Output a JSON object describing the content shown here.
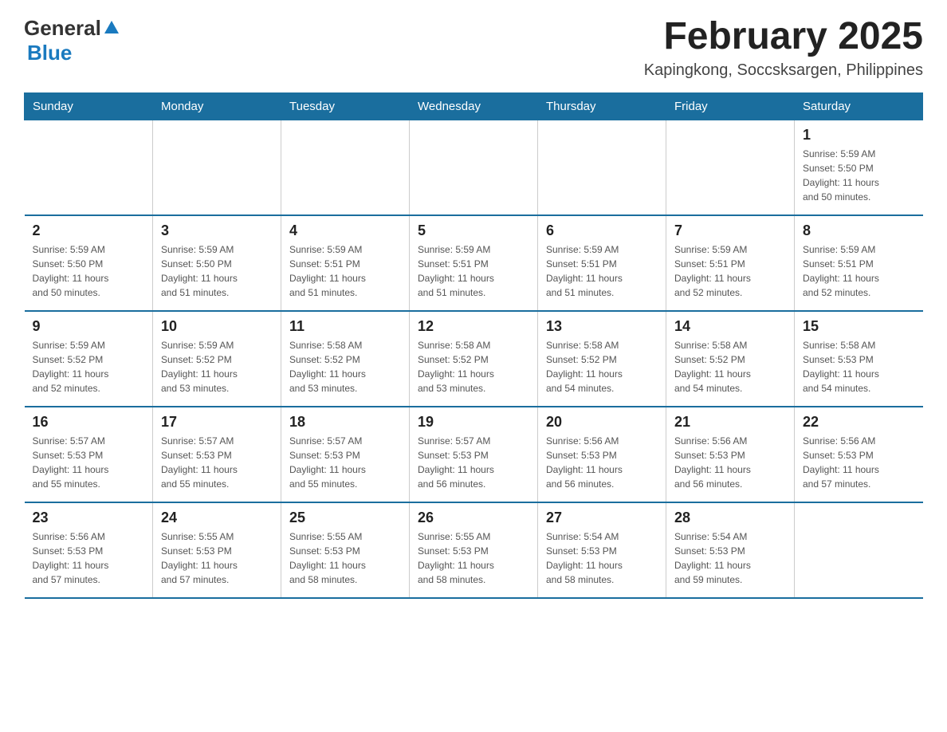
{
  "logo": {
    "general": "General",
    "blue": "Blue"
  },
  "title": "February 2025",
  "location": "Kapingkong, Soccsksargen, Philippines",
  "days_of_week": [
    "Sunday",
    "Monday",
    "Tuesday",
    "Wednesday",
    "Thursday",
    "Friday",
    "Saturday"
  ],
  "weeks": [
    [
      {
        "day": "",
        "info": ""
      },
      {
        "day": "",
        "info": ""
      },
      {
        "day": "",
        "info": ""
      },
      {
        "day": "",
        "info": ""
      },
      {
        "day": "",
        "info": ""
      },
      {
        "day": "",
        "info": ""
      },
      {
        "day": "1",
        "info": "Sunrise: 5:59 AM\nSunset: 5:50 PM\nDaylight: 11 hours\nand 50 minutes."
      }
    ],
    [
      {
        "day": "2",
        "info": "Sunrise: 5:59 AM\nSunset: 5:50 PM\nDaylight: 11 hours\nand 50 minutes."
      },
      {
        "day": "3",
        "info": "Sunrise: 5:59 AM\nSunset: 5:50 PM\nDaylight: 11 hours\nand 51 minutes."
      },
      {
        "day": "4",
        "info": "Sunrise: 5:59 AM\nSunset: 5:51 PM\nDaylight: 11 hours\nand 51 minutes."
      },
      {
        "day": "5",
        "info": "Sunrise: 5:59 AM\nSunset: 5:51 PM\nDaylight: 11 hours\nand 51 minutes."
      },
      {
        "day": "6",
        "info": "Sunrise: 5:59 AM\nSunset: 5:51 PM\nDaylight: 11 hours\nand 51 minutes."
      },
      {
        "day": "7",
        "info": "Sunrise: 5:59 AM\nSunset: 5:51 PM\nDaylight: 11 hours\nand 52 minutes."
      },
      {
        "day": "8",
        "info": "Sunrise: 5:59 AM\nSunset: 5:51 PM\nDaylight: 11 hours\nand 52 minutes."
      }
    ],
    [
      {
        "day": "9",
        "info": "Sunrise: 5:59 AM\nSunset: 5:52 PM\nDaylight: 11 hours\nand 52 minutes."
      },
      {
        "day": "10",
        "info": "Sunrise: 5:59 AM\nSunset: 5:52 PM\nDaylight: 11 hours\nand 53 minutes."
      },
      {
        "day": "11",
        "info": "Sunrise: 5:58 AM\nSunset: 5:52 PM\nDaylight: 11 hours\nand 53 minutes."
      },
      {
        "day": "12",
        "info": "Sunrise: 5:58 AM\nSunset: 5:52 PM\nDaylight: 11 hours\nand 53 minutes."
      },
      {
        "day": "13",
        "info": "Sunrise: 5:58 AM\nSunset: 5:52 PM\nDaylight: 11 hours\nand 54 minutes."
      },
      {
        "day": "14",
        "info": "Sunrise: 5:58 AM\nSunset: 5:52 PM\nDaylight: 11 hours\nand 54 minutes."
      },
      {
        "day": "15",
        "info": "Sunrise: 5:58 AM\nSunset: 5:53 PM\nDaylight: 11 hours\nand 54 minutes."
      }
    ],
    [
      {
        "day": "16",
        "info": "Sunrise: 5:57 AM\nSunset: 5:53 PM\nDaylight: 11 hours\nand 55 minutes."
      },
      {
        "day": "17",
        "info": "Sunrise: 5:57 AM\nSunset: 5:53 PM\nDaylight: 11 hours\nand 55 minutes."
      },
      {
        "day": "18",
        "info": "Sunrise: 5:57 AM\nSunset: 5:53 PM\nDaylight: 11 hours\nand 55 minutes."
      },
      {
        "day": "19",
        "info": "Sunrise: 5:57 AM\nSunset: 5:53 PM\nDaylight: 11 hours\nand 56 minutes."
      },
      {
        "day": "20",
        "info": "Sunrise: 5:56 AM\nSunset: 5:53 PM\nDaylight: 11 hours\nand 56 minutes."
      },
      {
        "day": "21",
        "info": "Sunrise: 5:56 AM\nSunset: 5:53 PM\nDaylight: 11 hours\nand 56 minutes."
      },
      {
        "day": "22",
        "info": "Sunrise: 5:56 AM\nSunset: 5:53 PM\nDaylight: 11 hours\nand 57 minutes."
      }
    ],
    [
      {
        "day": "23",
        "info": "Sunrise: 5:56 AM\nSunset: 5:53 PM\nDaylight: 11 hours\nand 57 minutes."
      },
      {
        "day": "24",
        "info": "Sunrise: 5:55 AM\nSunset: 5:53 PM\nDaylight: 11 hours\nand 57 minutes."
      },
      {
        "day": "25",
        "info": "Sunrise: 5:55 AM\nSunset: 5:53 PM\nDaylight: 11 hours\nand 58 minutes."
      },
      {
        "day": "26",
        "info": "Sunrise: 5:55 AM\nSunset: 5:53 PM\nDaylight: 11 hours\nand 58 minutes."
      },
      {
        "day": "27",
        "info": "Sunrise: 5:54 AM\nSunset: 5:53 PM\nDaylight: 11 hours\nand 58 minutes."
      },
      {
        "day": "28",
        "info": "Sunrise: 5:54 AM\nSunset: 5:53 PM\nDaylight: 11 hours\nand 59 minutes."
      },
      {
        "day": "",
        "info": ""
      }
    ]
  ]
}
